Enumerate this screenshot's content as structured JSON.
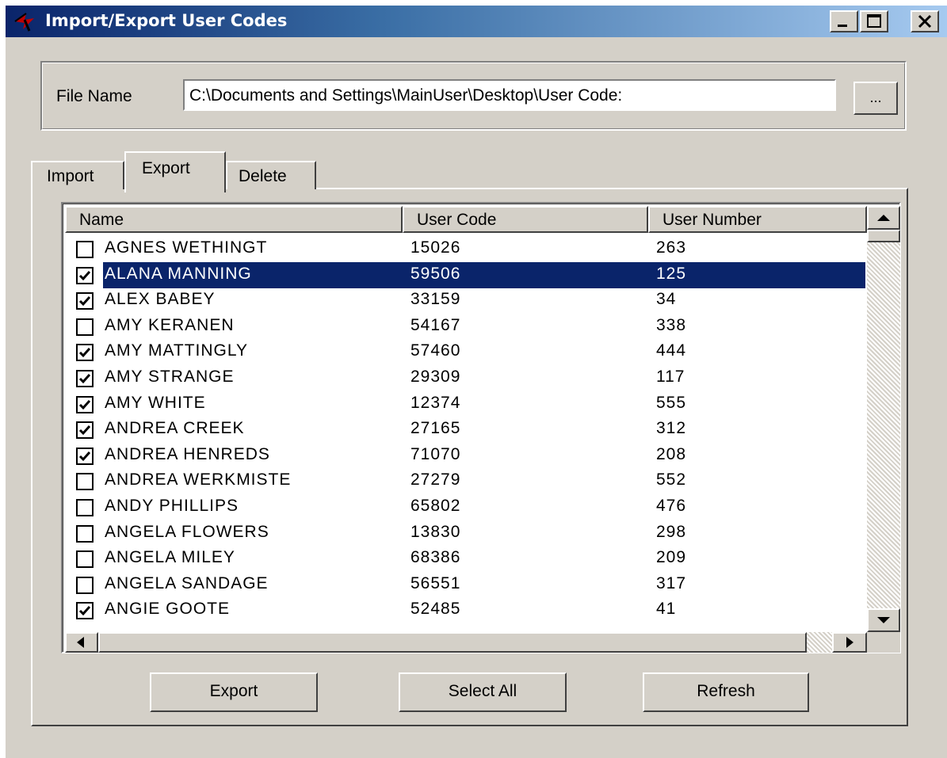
{
  "window": {
    "title": "Import/Export User Codes"
  },
  "file": {
    "label": "File Name",
    "value": "C:\\Documents and Settings\\MainUser\\Desktop\\User Code:",
    "browse_label": "..."
  },
  "tabs": [
    {
      "label": "Import",
      "active": false
    },
    {
      "label": "Export",
      "active": true
    },
    {
      "label": "Delete",
      "active": false
    }
  ],
  "list": {
    "columns": [
      "Name",
      "User Code",
      "User Number"
    ],
    "rows": [
      {
        "name": "AGNES WETHINGT",
        "code": "15026",
        "number": "263",
        "checked": false,
        "selected": false
      },
      {
        "name": "ALANA MANNING",
        "code": "59506",
        "number": "125",
        "checked": true,
        "selected": true
      },
      {
        "name": "ALEX BABEY",
        "code": "33159",
        "number": "34",
        "checked": true,
        "selected": false
      },
      {
        "name": "AMY KERANEN",
        "code": "54167",
        "number": "338",
        "checked": false,
        "selected": false
      },
      {
        "name": "AMY MATTINGLY",
        "code": "57460",
        "number": "444",
        "checked": true,
        "selected": false
      },
      {
        "name": "AMY STRANGE",
        "code": "29309",
        "number": "117",
        "checked": true,
        "selected": false
      },
      {
        "name": "AMY WHITE",
        "code": "12374",
        "number": "555",
        "checked": true,
        "selected": false
      },
      {
        "name": "ANDREA CREEK",
        "code": "27165",
        "number": "312",
        "checked": true,
        "selected": false
      },
      {
        "name": "ANDREA HENREDS",
        "code": "71070",
        "number": "208",
        "checked": true,
        "selected": false
      },
      {
        "name": "ANDREA WERKMISTE",
        "code": "27279",
        "number": "552",
        "checked": false,
        "selected": false
      },
      {
        "name": "ANDY PHILLIPS",
        "code": "65802",
        "number": "476",
        "checked": false,
        "selected": false
      },
      {
        "name": "ANGELA FLOWERS",
        "code": "13830",
        "number": "298",
        "checked": false,
        "selected": false
      },
      {
        "name": "ANGELA MILEY",
        "code": "68386",
        "number": "209",
        "checked": false,
        "selected": false
      },
      {
        "name": "ANGELA SANDAGE",
        "code": "56551",
        "number": "317",
        "checked": false,
        "selected": false
      },
      {
        "name": "ANGIE GOOTE",
        "code": "52485",
        "number": "41",
        "checked": true,
        "selected": false
      }
    ]
  },
  "buttons": {
    "export": "Export",
    "select_all": "Select All",
    "refresh": "Refresh"
  },
  "colors": {
    "title_active": "#0a246a",
    "selection": "#0a246a",
    "face": "#d4d0c8"
  }
}
